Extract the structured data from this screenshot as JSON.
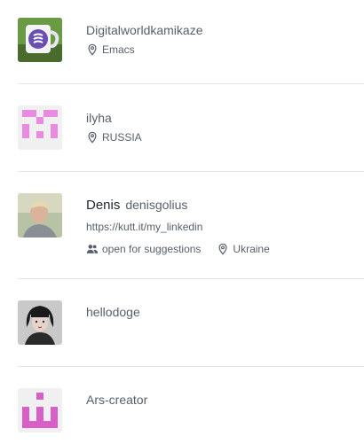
{
  "users": [
    {
      "name": "Digitalworldkamikaze",
      "location": "Emacs",
      "avatar_icon": "emacs-mug-avatar"
    },
    {
      "name": "ilyha",
      "location": "RUSSIA",
      "avatar_icon": "pink-identicon-avatar"
    },
    {
      "name": "Denis",
      "login": "denisgolius",
      "link": "https://kutt.it/my_linkedin",
      "bio": "open for suggestions",
      "location": "Ukraine",
      "avatar_icon": "photo-avatar"
    },
    {
      "name": "hellodoge",
      "avatar_icon": "photo-avatar"
    },
    {
      "name": "Ars-creator",
      "avatar_icon": "pink-identicon-avatar"
    }
  ],
  "colors": {
    "identicon_pink": "#e98bde",
    "divider": "#e1e4e8",
    "text_muted": "#57606a",
    "text_primary": "#24292f"
  }
}
